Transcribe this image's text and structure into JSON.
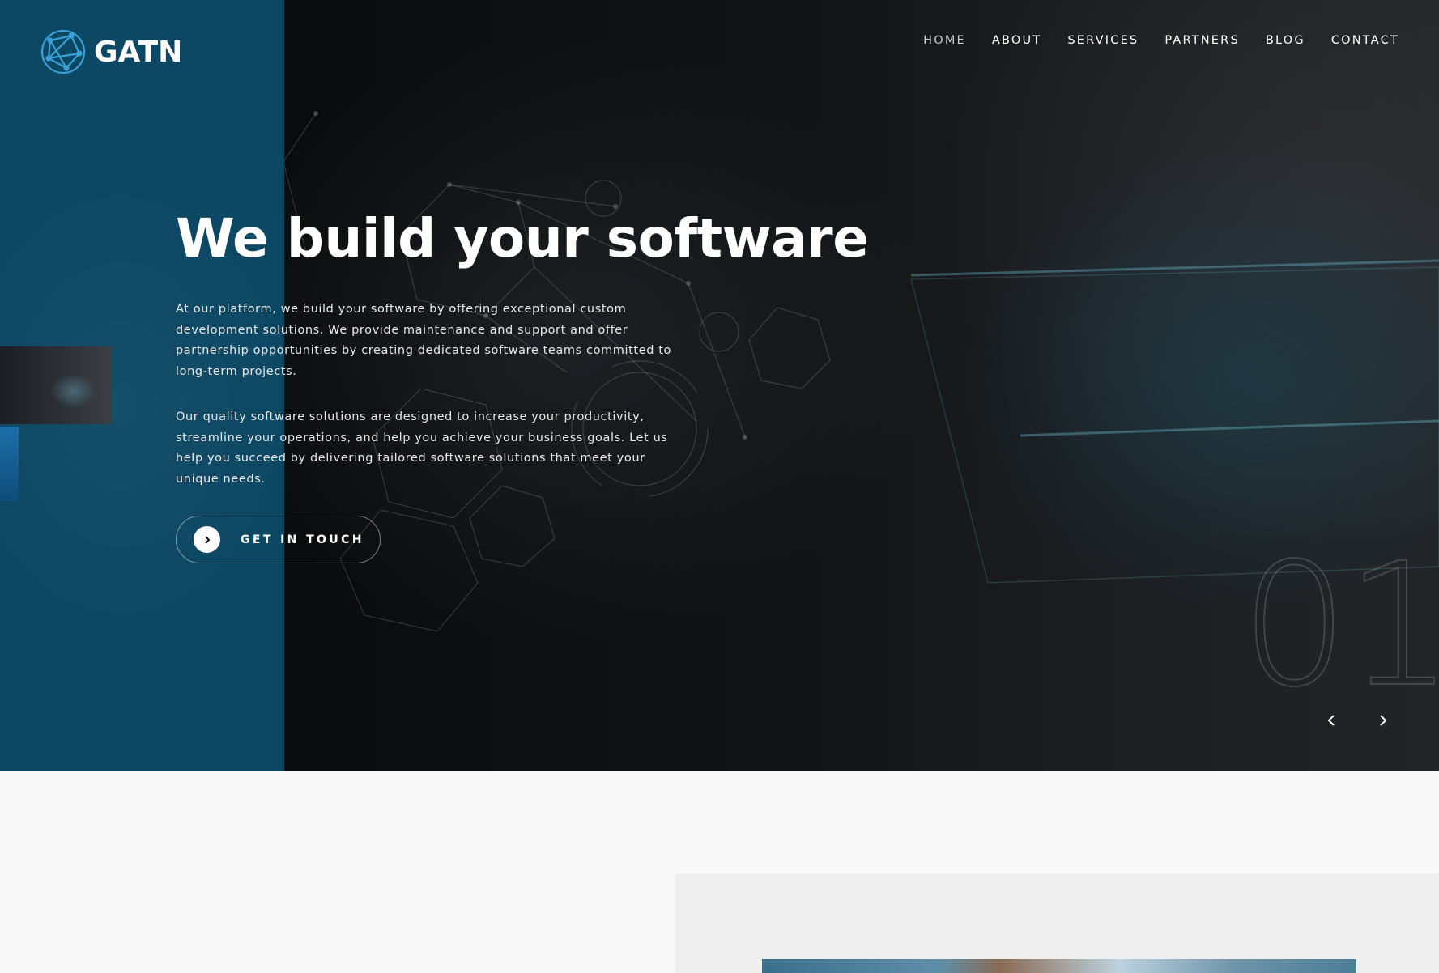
{
  "brand": {
    "logo_text": "GATN",
    "accent_color": "#0c4763",
    "logo_color": "#3aa0d8"
  },
  "nav": {
    "items": [
      {
        "label": "HOME",
        "active": true
      },
      {
        "label": "ABOUT"
      },
      {
        "label": "SERVICES"
      },
      {
        "label": "PARTNERS"
      },
      {
        "label": "BLOG"
      },
      {
        "label": "CONTACT"
      }
    ]
  },
  "hero": {
    "title": "We build your software",
    "paragraph_1": "At our platform, we build your software by offering exceptional custom development solutions. We provide maintenance and support and offer partnership opportunities by creating dedicated software teams committed to long-term projects.",
    "paragraph_2": "Our quality software solutions are designed to increase your productivity, streamline your operations, and help you achieve your business goals. Let us help you succeed by delivering tailored software solutions that meet your unique needs.",
    "cta_label": "GET IN TOUCH",
    "slide_number": "01",
    "icons": {
      "cta": "chevron-right-icon",
      "prev": "chevron-left-icon",
      "next": "chevron-right-icon"
    }
  }
}
